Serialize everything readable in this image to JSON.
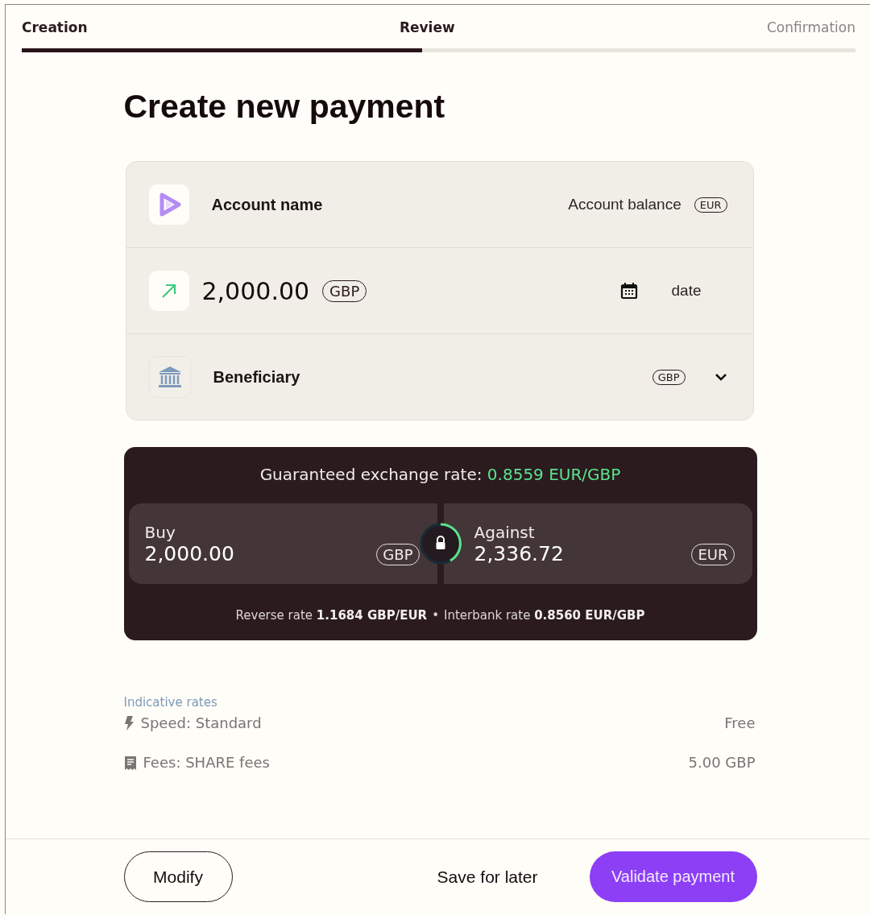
{
  "steps": [
    {
      "label": "Creation",
      "completed": true
    },
    {
      "label": "Review",
      "completed": true
    },
    {
      "label": "Confirmation",
      "completed": false
    }
  ],
  "progress": {
    "level": 0.48
  },
  "title": "Create new payment",
  "account": {
    "name": "Account name",
    "balance_label": "Account balance",
    "currency": "EUR"
  },
  "amount": {
    "value": "2,000.00",
    "currency": "GBP",
    "date": "date"
  },
  "beneficiary": {
    "name": "Beneficiary",
    "currency": "GBP",
    "expanded": false
  },
  "exchange": {
    "label": "Guaranteed exchange rate:",
    "rate": "0.8559 EUR/GBP",
    "buy": {
      "label": "Buy",
      "value": "2,000.00",
      "currency": "GBP"
    },
    "against": {
      "label": "Against",
      "value": "2,336.72",
      "currency": "EUR"
    },
    "reverse_label": "Reverse rate",
    "reverse_value": "1.1684 GBP/EUR",
    "separator": "•",
    "interbank_label": "Interbank rate",
    "interbank_value": "0.8560 EUR/GBP"
  },
  "indicative": {
    "heading": "Indicative rates",
    "rows": [
      {
        "kind": "speed",
        "label": "Speed: Standard",
        "value": "Free"
      },
      {
        "kind": "fees",
        "label": "Fees: SHARE fees",
        "value": "5.00 GBP"
      }
    ]
  },
  "actions": {
    "modify": "Modify",
    "save": "Save for later",
    "validate": "Validate payment"
  }
}
